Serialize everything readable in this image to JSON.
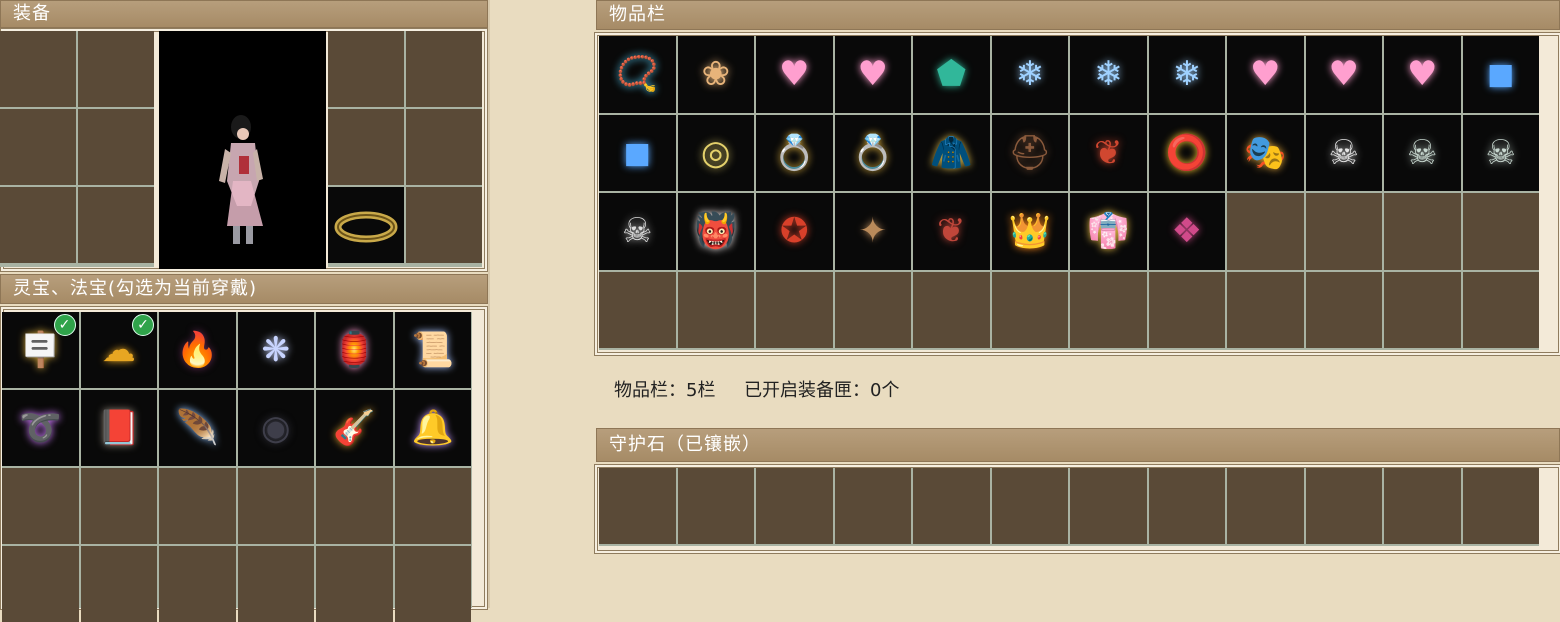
{
  "equip": {
    "title": "装备",
    "belt_icon": "belt-icon"
  },
  "lingbao": {
    "title": "灵宝、法宝(勾选为当前穿戴)",
    "items": [
      {
        "icon": "talisman-plaque-icon",
        "glyph": "🪧",
        "color": "#d3a83b",
        "checked": true
      },
      {
        "icon": "golden-cloud-icon",
        "glyph": "☁",
        "color": "#e7a622",
        "checked": true
      },
      {
        "icon": "dark-flame-icon",
        "glyph": "🔥",
        "color": "#6a2c5a",
        "checked": false
      },
      {
        "icon": "spirit-wisp-icon",
        "glyph": "❋",
        "color": "#c8d4ff",
        "checked": false
      },
      {
        "icon": "glowing-lantern-icon",
        "glyph": "🏮",
        "color": "#ff9ad0",
        "checked": false
      },
      {
        "icon": "scroll-icon",
        "glyph": "📜",
        "color": "#a9c3ff",
        "checked": false
      },
      {
        "icon": "whip-icon",
        "glyph": "➰",
        "color": "#d07bff",
        "checked": false
      },
      {
        "icon": "tome-icon",
        "glyph": "📕",
        "color": "#8d8376",
        "checked": false
      },
      {
        "icon": "blue-fan-icon",
        "glyph": "🪶",
        "color": "#8fc0ff",
        "checked": false
      },
      {
        "icon": "dark-orb-icon",
        "glyph": "◉",
        "color": "#3e3e4a",
        "checked": false
      },
      {
        "icon": "lute-icon",
        "glyph": "🎸",
        "color": "#d49a2e",
        "checked": false
      },
      {
        "icon": "chime-bells-icon",
        "glyph": "🔔",
        "color": "#c79bff",
        "checked": false
      }
    ]
  },
  "inventory": {
    "title": "物品栏",
    "items": [
      {
        "icon": "blue-prayer-beads-icon",
        "glyph": "📿",
        "color": "#59d4ff"
      },
      {
        "icon": "flower-crown-icon",
        "glyph": "❀",
        "color": "#e8b47a"
      },
      {
        "icon": "pink-heart-icon",
        "glyph": "♥",
        "color": "#ff9fcf"
      },
      {
        "icon": "pink-heart-icon",
        "glyph": "♥",
        "color": "#ff9fcf"
      },
      {
        "icon": "jade-gem-icon",
        "glyph": "⬟",
        "color": "#31b79a"
      },
      {
        "icon": "ice-crystal-icon",
        "glyph": "❄",
        "color": "#9fd1ff"
      },
      {
        "icon": "ice-crystal-icon",
        "glyph": "❄",
        "color": "#9fd1ff"
      },
      {
        "icon": "ice-crystal-icon",
        "glyph": "❄",
        "color": "#9fd1ff"
      },
      {
        "icon": "pink-heart-icon",
        "glyph": "♥",
        "color": "#ff9fcf"
      },
      {
        "icon": "pink-heart-icon",
        "glyph": "♥",
        "color": "#ff9fcf"
      },
      {
        "icon": "pink-heart-icon",
        "glyph": "♥",
        "color": "#ff9fcf"
      },
      {
        "icon": "ice-cube-icon",
        "glyph": "◼",
        "color": "#5aa8ff"
      },
      {
        "icon": "ice-cube-icon",
        "glyph": "◼",
        "color": "#5aa8ff"
      },
      {
        "icon": "jade-amulet-icon",
        "glyph": "◎",
        "color": "#e3d06b"
      },
      {
        "icon": "emerald-ring-icon",
        "glyph": "💍",
        "color": "#e5b63f"
      },
      {
        "icon": "emerald-ring-icon",
        "glyph": "💍",
        "color": "#e5b63f"
      },
      {
        "icon": "golden-cloak-icon",
        "glyph": "🧥",
        "color": "#d2b24a"
      },
      {
        "icon": "dark-helmet-icon",
        "glyph": "⛑",
        "color": "#8a5a3c"
      },
      {
        "icon": "red-necklace-icon",
        "glyph": "❦",
        "color": "#d04730"
      },
      {
        "icon": "gold-ring-icon",
        "glyph": "⭕",
        "color": "#f0c030"
      },
      {
        "icon": "golden-mask-icon",
        "glyph": "🎭",
        "color": "#e0a43a"
      },
      {
        "icon": "skull-bracelet-icon",
        "glyph": "☠",
        "color": "#e4e4e4"
      },
      {
        "icon": "silver-skull-ring-icon",
        "glyph": "☠",
        "color": "#c8d8d0"
      },
      {
        "icon": "silver-skull-ring-icon",
        "glyph": "☠",
        "color": "#c8d8d0"
      },
      {
        "icon": "skull-pendant-icon",
        "glyph": "☠",
        "color": "#dddddd"
      },
      {
        "icon": "demon-mask-icon",
        "glyph": "👹",
        "color": "#e8e0e0"
      },
      {
        "icon": "red-amulet-icon",
        "glyph": "✪",
        "color": "#d8402a"
      },
      {
        "icon": "small-pendant-icon",
        "glyph": "✦",
        "color": "#b98a5a"
      },
      {
        "icon": "red-necklace-icon",
        "glyph": "❦",
        "color": "#c0463a"
      },
      {
        "icon": "flame-crown-icon",
        "glyph": "👑",
        "color": "#ff8a1a"
      },
      {
        "icon": "golden-robe-icon",
        "glyph": "👘",
        "color": "#f0c448"
      },
      {
        "icon": "purple-emblem-icon",
        "glyph": "❖",
        "color": "#d04a8a"
      }
    ]
  },
  "status": {
    "slots_label": "物品栏：5栏",
    "boxes_label": "已开启装备匣：0个"
  },
  "guard": {
    "title": "守护石（已镶嵌）"
  }
}
